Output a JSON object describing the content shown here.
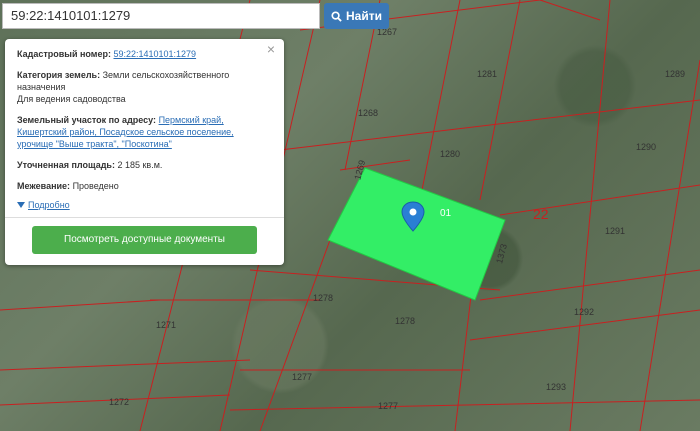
{
  "search": {
    "value": "59:22:1410101:1279",
    "button_label": "Найти"
  },
  "popup": {
    "cadastral_label": "Кадастровый номер:",
    "cadastral_value": "59:22:1410101:1279",
    "category_label": "Категория земель:",
    "category_value": "Земли сельскохозяйственного назначения",
    "usage": "Для ведения садоводства",
    "address_label": "Земельный участок по адресу:",
    "address_value": "Пермский край, Кишертский район, Посадское сельское поселение, урочище \"Выше тракта\", \"Поскотина\"",
    "area_label": "Уточненная площадь:",
    "area_value": "2 185 кв.м.",
    "survey_label": "Межевание:",
    "survey_value": "Проведено",
    "details_link": "Подробно",
    "docs_button": "Посмотреть доступные документы",
    "close_symbol": "×"
  },
  "map": {
    "parcels": [
      "1267",
      "1281",
      "1289",
      "1268",
      "1280",
      "1290",
      "1269",
      "1291",
      "1373",
      "1278",
      "1292",
      "1271",
      "1278",
      "1277",
      "1293",
      "1272",
      "1277"
    ],
    "quarter_number": "22",
    "highlight_color": "#33ee66",
    "boundary_color": "#c82020",
    "marker_label": "01"
  },
  "icons": {
    "search": "search-icon",
    "marker": "map-marker-icon",
    "caret": "caret-down-icon"
  }
}
